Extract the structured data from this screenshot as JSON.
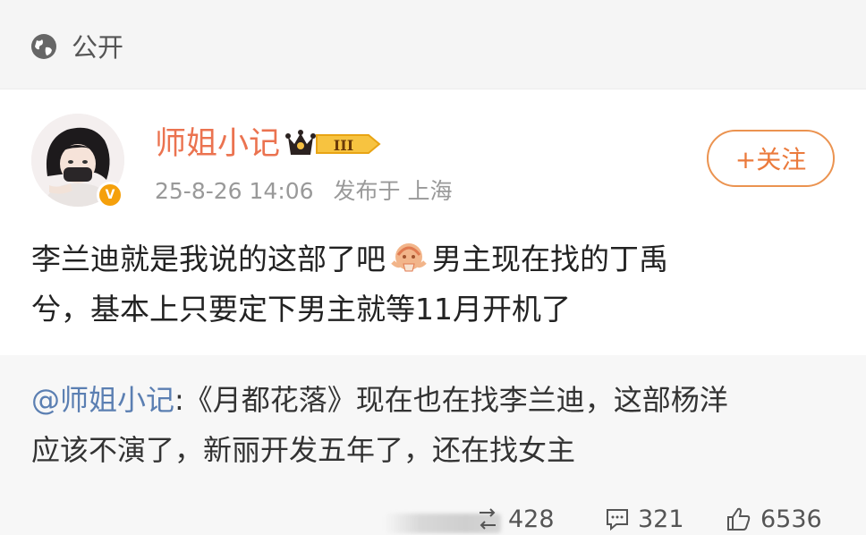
{
  "visibility": {
    "icon": "globe-icon",
    "label": "公开"
  },
  "author": {
    "name": "师姐小记",
    "avatar_icon": "avatar-girl",
    "verified_icon": "v-badge",
    "level_badge": "crown-III-badge",
    "level_text": "III"
  },
  "post_meta": {
    "time": "25-8-26 14:06",
    "source": "发布于 上海"
  },
  "follow": {
    "label": "+关注"
  },
  "post": {
    "line1_before": "李兰迪就是我说的这部了吧",
    "emoji": "shrug-emoji",
    "line1_after": "男主现在找的丁禹",
    "line2": "兮，基本上只要定下男主就等11月开机了"
  },
  "repost": {
    "mention": "@师姐小记",
    "line1_rest": ":《月都花落》现在也在找李兰迪，这部杨洋",
    "line2": "应该不演了，新丽开发五年了，还在找女主"
  },
  "stats": {
    "reposts": "428",
    "comments": "321",
    "likes": "6536"
  },
  "colors": {
    "accent": "#eb7350",
    "mention": "#5b7fb2",
    "badge_gold": "#f5a00b"
  }
}
